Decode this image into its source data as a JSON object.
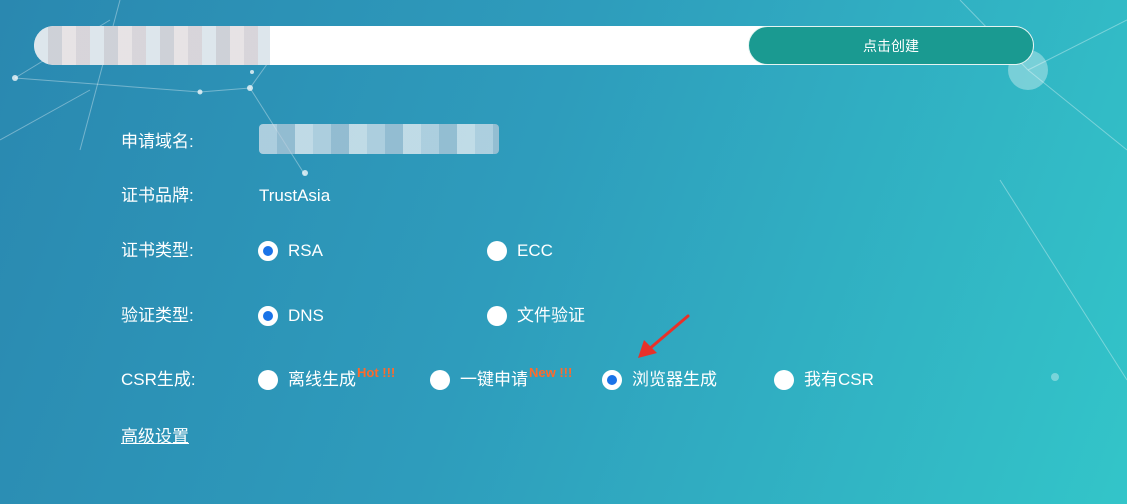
{
  "header": {
    "create_button_label": "点击创建"
  },
  "form": {
    "domain": {
      "label": "申请域名:"
    },
    "brand": {
      "label": "证书品牌:",
      "value": "TrustAsia"
    },
    "cert_type": {
      "label": "证书类型:",
      "options": [
        {
          "label": "RSA",
          "checked": true
        },
        {
          "label": "ECC",
          "checked": false
        }
      ]
    },
    "verify_type": {
      "label": "验证类型:",
      "options": [
        {
          "label": "DNS",
          "checked": true
        },
        {
          "label": "文件验证",
          "checked": false
        }
      ]
    },
    "csr": {
      "label": "CSR生成:",
      "options": [
        {
          "label": "离线生成",
          "tag": "Hot !!!",
          "checked": false
        },
        {
          "label": "一键申请",
          "tag": "New !!!",
          "checked": false
        },
        {
          "label": "浏览器生成",
          "checked": true
        },
        {
          "label": "我有CSR",
          "checked": false
        }
      ]
    },
    "advanced_link": "高级设置"
  },
  "colors": {
    "accent_button": "#1a9a91",
    "radio_checked": "#1a73e8",
    "tag": "#ff6a2b",
    "annotation_arrow": "#e8312a"
  },
  "annotation": {
    "icon": "red-arrow-icon"
  }
}
